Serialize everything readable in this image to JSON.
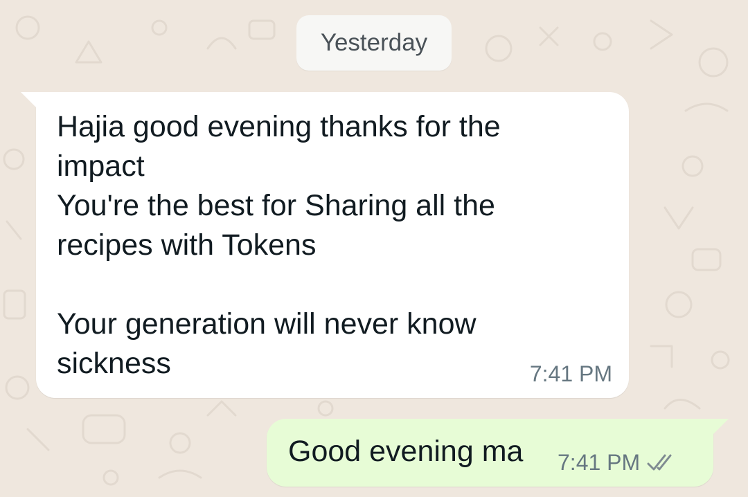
{
  "chat": {
    "date_separator": "Yesterday",
    "messages": [
      {
        "direction": "incoming",
        "text": "Hajia good evening thanks for the\nimpact\nYou're the best for Sharing all the\nrecipes with Tokens\n\nYour generation will never know\nsickness",
        "time": "7:41 PM"
      },
      {
        "direction": "outgoing",
        "text": "Good evening ma",
        "time": "7:41 PM",
        "status_icon": "double-check-icon"
      }
    ]
  },
  "colors": {
    "wallpaper": "#efe7de",
    "incoming_bubble": "#ffffff",
    "outgoing_bubble": "#e7fcd6",
    "message_text": "#111b21",
    "timestamp": "#667781"
  }
}
